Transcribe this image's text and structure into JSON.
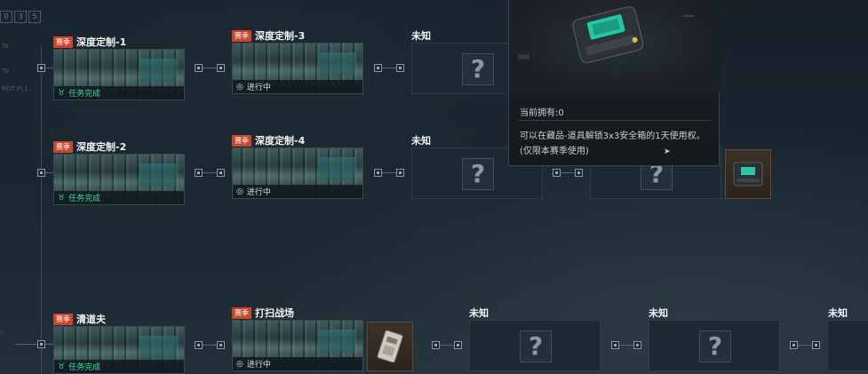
{
  "tabs": [
    "0",
    "3",
    "5"
  ],
  "side_labels": [
    "Ta",
    "Ta",
    "ROT Pl.1"
  ],
  "rows": {
    "row1": {
      "col1": {
        "badge": "赛季",
        "title": "深度定制-1",
        "status": "任务完成"
      },
      "col2": {
        "badge": "赛季",
        "title": "深度定制-3",
        "status": "进行中"
      },
      "col3": {
        "title": "未知",
        "mark": "?"
      }
    },
    "row2": {
      "col1": {
        "badge": "赛季",
        "title": "深度定制-2",
        "status": "任务完成"
      },
      "col2": {
        "badge": "赛季",
        "title": "深度定制-4",
        "status": "进行中"
      },
      "col3": {
        "title": "未知",
        "mark": "?"
      },
      "col4": {
        "mark": "?"
      }
    },
    "row3": {
      "col1": {
        "badge": "赛季",
        "title": "清道夫",
        "status": "任务完成"
      },
      "col2": {
        "badge": "赛季",
        "title": "打扫战场",
        "status": "进行中"
      },
      "col3": {
        "title": "未知",
        "mark": "?"
      },
      "col4": {
        "title": "未知",
        "mark": "?"
      },
      "col5": {
        "title": "未知"
      }
    }
  },
  "tooltip": {
    "owned": "当前拥有:0",
    "description": "可以在藏品-道具解锁3x3安全箱的1天使用权。(仅限本赛季使用)"
  },
  "colors": {
    "badge": "#c8462d",
    "done": "#3fd99e",
    "bg": "#1b2731"
  },
  "icons": [
    "trophy-icon",
    "progress-icon",
    "question-mark-icon",
    "safe-box-icon",
    "card-item-icon",
    "cursor-icon"
  ]
}
